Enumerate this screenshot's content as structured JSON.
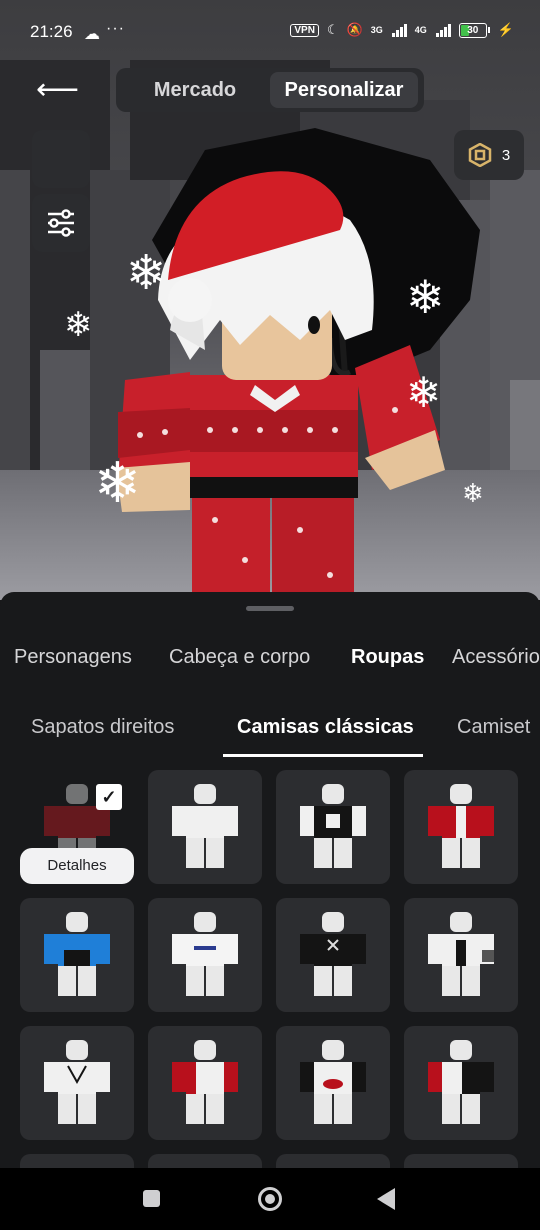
{
  "status_bar": {
    "time": "21:26",
    "weather_icon": "cloud-icon",
    "more": "···",
    "vpn": "VPN",
    "net1": "3G",
    "net2": "4G",
    "battery": "30"
  },
  "top_nav": {
    "back_icon": "arrow-left-icon",
    "tabs": [
      {
        "label": "Mercado",
        "selected": false
      },
      {
        "label": "Personalizar",
        "selected": true
      }
    ],
    "robux_balance": "3"
  },
  "categories": [
    {
      "label": "Personagens"
    },
    {
      "label": "Cabeça e corpo"
    },
    {
      "label": "Roupas",
      "selected": true
    },
    {
      "label": "Acessório"
    }
  ],
  "subcategories": [
    {
      "label": "Sapatos direitos"
    },
    {
      "label": "Camisas clássicas",
      "selected": true
    },
    {
      "label": "Camiset"
    }
  ],
  "details_label": "Detalhes",
  "items_colors": [
    [
      "#7a1a1a",
      "#f0f0f0",
      "#141414",
      "#b8101c"
    ],
    [
      "#1f7fd8",
      "#f0f0f0",
      "#141414",
      "#f0f0f0"
    ],
    [
      "#f0f0f0",
      "#b8101c",
      "#f0f0f0",
      "#f0f0f0"
    ]
  ],
  "colors": {
    "background": "#18191b",
    "tile": "#2c2d30",
    "accent": "#ffffff"
  }
}
